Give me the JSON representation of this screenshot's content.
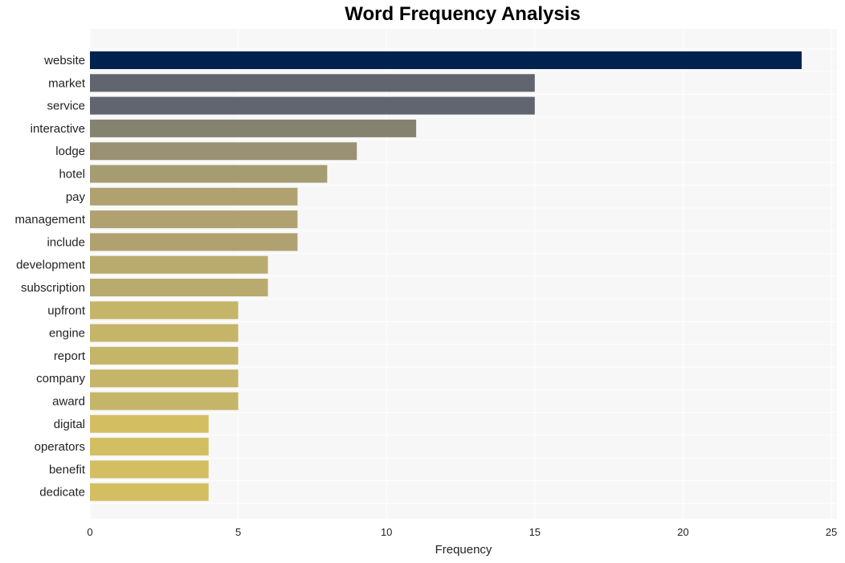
{
  "chart_data": {
    "type": "bar",
    "orientation": "horizontal",
    "title": "Word Frequency Analysis",
    "xlabel": "Frequency",
    "ylabel": "",
    "xlim": [
      0,
      25
    ],
    "xticks": [
      0,
      5,
      10,
      15,
      20,
      25
    ],
    "grid": true,
    "categories": [
      "website",
      "market",
      "service",
      "interactive",
      "lodge",
      "hotel",
      "pay",
      "management",
      "include",
      "development",
      "subscription",
      "upfront",
      "engine",
      "report",
      "company",
      "award",
      "digital",
      "operators",
      "benefit",
      "dedicate"
    ],
    "values": [
      24,
      15,
      15,
      11,
      9,
      8,
      7,
      7,
      7,
      6,
      6,
      5,
      5,
      5,
      5,
      5,
      4,
      4,
      4,
      4
    ],
    "colors": [
      "#00224e",
      "#61656f",
      "#61656f",
      "#85836f",
      "#9a9174",
      "#a59c71",
      "#afa270",
      "#afa270",
      "#afa270",
      "#b9ab6e",
      "#b9ab6e",
      "#c5b569",
      "#c5b569",
      "#c5b569",
      "#c5b569",
      "#c5b569",
      "#d3be62",
      "#d3be62",
      "#d3be62",
      "#d3be62"
    ],
    "background": "#f7f7f7"
  }
}
